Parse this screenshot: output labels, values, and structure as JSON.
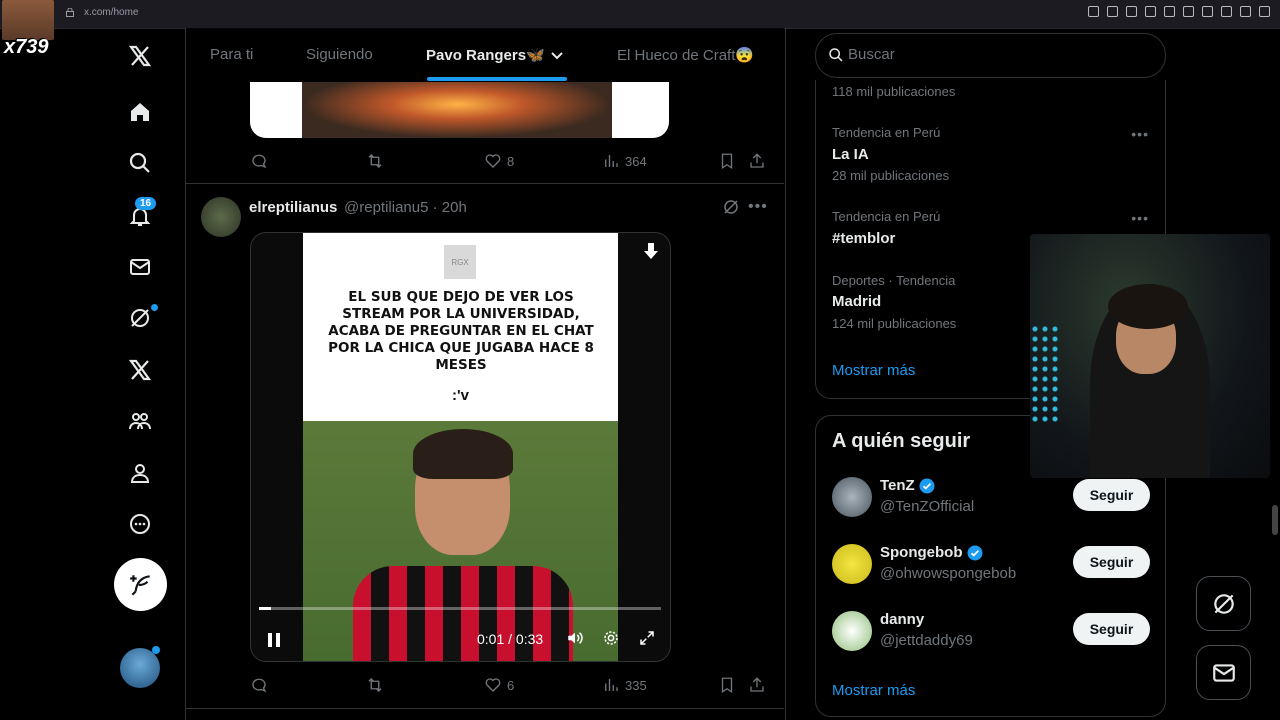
{
  "browser": {
    "url": "x.com/home"
  },
  "overlay": {
    "counter": "x739"
  },
  "nav": {
    "notifications_badge": "16"
  },
  "tabs": [
    {
      "label": "Para ti"
    },
    {
      "label": "Siguiendo"
    },
    {
      "label": "Pavo Rangers🦋"
    },
    {
      "label": "El Hueco de Craft😨"
    }
  ],
  "post1": {
    "likes": "8",
    "views": "364"
  },
  "post2": {
    "name": "elreptilianus",
    "handle": "@reptilianu5 · 20h",
    "meme_logo": "RGX",
    "meme_text": "EL SUB QUE DEJO DE VER LOS STREAM POR LA UNIVERSIDAD, ACABA DE PREGUNTAR EN EL CHAT POR LA CHICA QUE JUGABA HACE 8 MESES",
    "meme_face": ":'v",
    "video_time": "0:01 / 0:33",
    "video_progress": 0.03,
    "likes": "6",
    "views": "335"
  },
  "search": {
    "placeholder": "Buscar"
  },
  "trends": {
    "top_count": "118 mil publicaciones",
    "items": [
      {
        "meta": "Tendencia en Perú",
        "title": "La IA",
        "count": "28 mil publicaciones"
      },
      {
        "meta": "Tendencia en Perú",
        "title": "#temblor",
        "count": ""
      },
      {
        "meta": "Deportes · Tendencia",
        "title": "Madrid",
        "count": "124 mil publicaciones"
      }
    ],
    "show_more": "Mostrar más"
  },
  "follow": {
    "title": "A quién seguir",
    "items": [
      {
        "name": "TenZ",
        "handle": "@TenZOfficial",
        "button": "Seguir",
        "verified": true
      },
      {
        "name": "Spongebob",
        "handle": "@ohwowspongebob",
        "button": "Seguir",
        "verified": true
      },
      {
        "name": "danny",
        "handle": "@jettdaddy69",
        "button": "Seguir",
        "verified": false
      }
    ],
    "show_more": "Mostrar más"
  },
  "colors": {
    "accent": "#1d9bf0",
    "bg": "#000000",
    "muted": "#71767b",
    "border": "#2f3336"
  }
}
